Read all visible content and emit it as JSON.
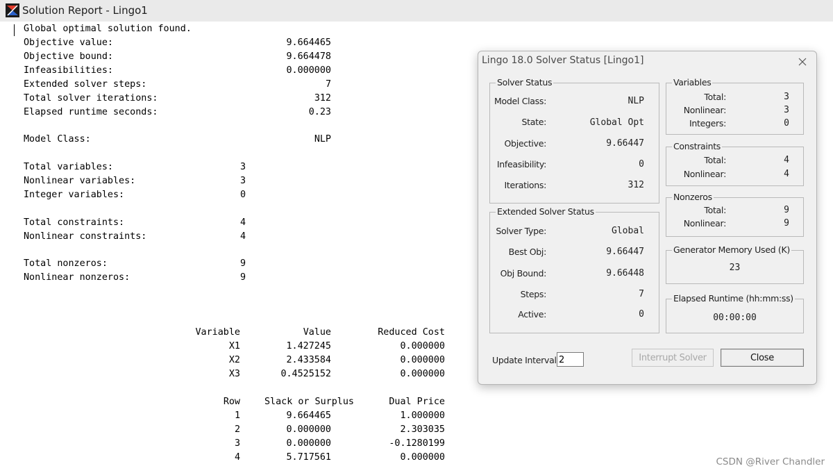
{
  "window": {
    "title": "Solution Report - Lingo1"
  },
  "report": {
    "summary": [
      {
        "label": "Global optimal solution found.",
        "value": ""
      },
      {
        "label": "Objective value:",
        "value": "9.664465"
      },
      {
        "label": "Objective bound:",
        "value": "9.664478"
      },
      {
        "label": "Infeasibilities:",
        "value": "0.000000"
      },
      {
        "label": "Extended solver steps:",
        "value": "7"
      },
      {
        "label": "Total solver iterations:",
        "value": "312"
      },
      {
        "label": "Elapsed runtime seconds:",
        "value": "0.23"
      }
    ],
    "model_class": {
      "label": "Model Class:",
      "value": "NLP"
    },
    "variables": [
      {
        "label": "Total variables:",
        "value": "3"
      },
      {
        "label": "Nonlinear variables:",
        "value": "3"
      },
      {
        "label": "Integer variables:",
        "value": "0"
      }
    ],
    "constraints": [
      {
        "label": "Total constraints:",
        "value": "4"
      },
      {
        "label": "Nonlinear constraints:",
        "value": "4"
      }
    ],
    "nonzeros": [
      {
        "label": "Total nonzeros:",
        "value": "9"
      },
      {
        "label": "Nonlinear nonzeros:",
        "value": "9"
      }
    ],
    "variable_table": {
      "headers": [
        "Variable",
        "Value",
        "Reduced Cost"
      ],
      "rows": [
        [
          "X1",
          "1.427245",
          "0.000000"
        ],
        [
          "X2",
          "2.433584",
          "0.000000"
        ],
        [
          "X3",
          "0.4525152",
          "0.000000"
        ]
      ]
    },
    "row_table": {
      "headers": [
        "Row",
        "Slack or Surplus",
        "Dual Price"
      ],
      "rows": [
        [
          "1",
          "9.664465",
          "1.000000"
        ],
        [
          "2",
          "0.000000",
          "2.303035"
        ],
        [
          "3",
          "0.000000",
          "-0.1280199"
        ],
        [
          "4",
          "5.717561",
          "0.000000"
        ]
      ]
    }
  },
  "dialog": {
    "title": "Lingo 18.0 Solver Status [Lingo1]",
    "solver_status": {
      "label": "Solver Status",
      "model_class_label": "Model Class:",
      "model_class": "NLP",
      "state_label": "State:",
      "state": "Global Opt",
      "objective_label": "Objective:",
      "objective": "9.66447",
      "infeasibility_label": "Infeasibility:",
      "infeasibility": "0",
      "iterations_label": "Iterations:",
      "iterations": "312"
    },
    "extended_status": {
      "label": "Extended Solver Status",
      "solver_type_label": "Solver Type:",
      "solver_type": "Global",
      "best_obj_label": "Best Obj:",
      "best_obj": "9.66447",
      "obj_bound_label": "Obj Bound:",
      "obj_bound": "9.66448",
      "steps_label": "Steps:",
      "steps": "7",
      "active_label": "Active:",
      "active": "0"
    },
    "variables": {
      "label": "Variables",
      "total_label": "Total:",
      "total": "3",
      "nonlinear_label": "Nonlinear:",
      "nonlinear": "3",
      "integers_label": "Integers:",
      "integers": "0"
    },
    "constraints": {
      "label": "Constraints",
      "total_label": "Total:",
      "total": "4",
      "nonlinear_label": "Nonlinear:",
      "nonlinear": "4"
    },
    "nonzeros": {
      "label": "Nonzeros",
      "total_label": "Total:",
      "total": "9",
      "nonlinear_label": "Nonlinear:",
      "nonlinear": "9"
    },
    "memory": {
      "label": "Generator Memory Used (K)",
      "value": "23"
    },
    "runtime": {
      "label": "Elapsed Runtime (hh:mm:ss)",
      "value": "00:00:00"
    },
    "update_interval": {
      "label": "Update Interval:",
      "value": "2"
    },
    "interrupt_label": "Interrupt Solver",
    "close_label": "Close"
  },
  "watermark": "CSDN @River Chandler"
}
